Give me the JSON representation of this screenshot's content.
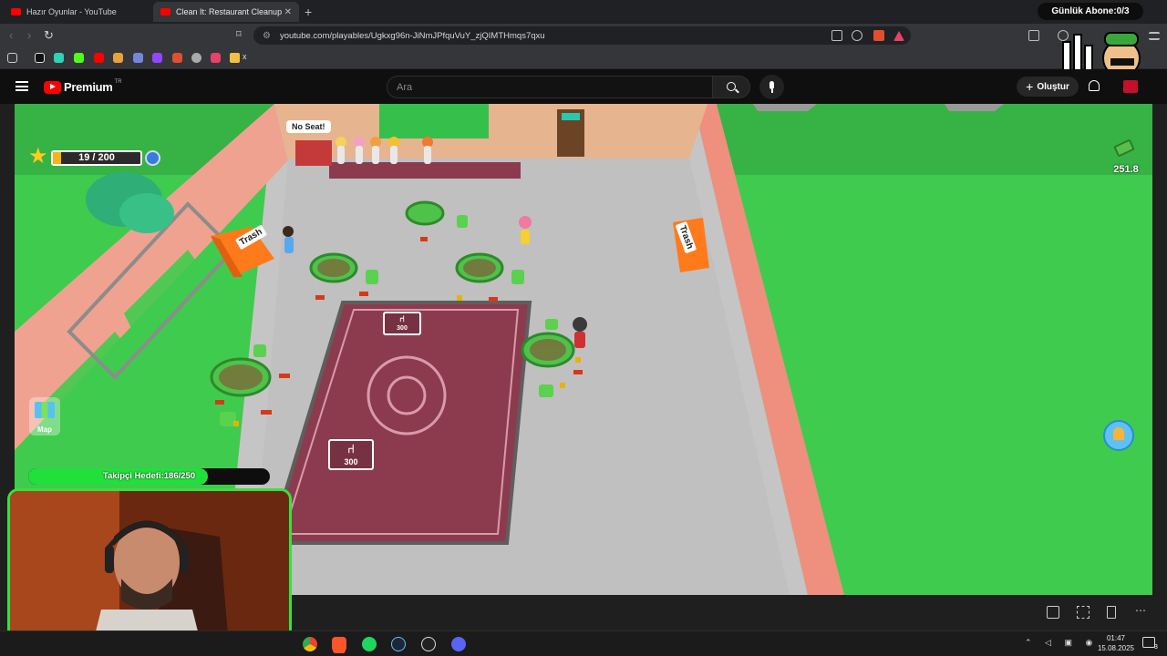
{
  "browser": {
    "tabs": [
      {
        "title": "Hazır Oyunlar - YouTube",
        "active": false
      },
      {
        "title": "Clean It: Restaurant Cleanup - Yo",
        "active": true
      }
    ],
    "new_tab": "+",
    "url": "youtube.com/playables/Ugkxg96n-JiNmJPfquVuY_zjQIMTHmqs7qxu",
    "bookmark_folder": "x"
  },
  "overlay": {
    "subscriber_goal": "Günlük Abone:0/3",
    "follower_goal_text": "Takipçi Hedefi:186/250",
    "follower_progress": 0.744
  },
  "youtube": {
    "brand": "Premium",
    "region": "TR",
    "search_placeholder": "Ara",
    "create_label": "Oluştur"
  },
  "game": {
    "level_progress_text": "19 / 200",
    "level_progress": 0.095,
    "money": "251.8",
    "no_seat_bubble": "No Seat!",
    "trash_left": "Trash",
    "trash_right": "Trash",
    "table_price_1": "300",
    "table_price_2": "300",
    "map_label": "Map",
    "colors": {
      "grass": "#3fcb4e",
      "floor": "#c9c9c9",
      "wall": "#f0a290",
      "carpet": "#8c3b4e",
      "trash": "#ff7a1a"
    }
  },
  "taskbar": {
    "time": "01:47",
    "date": "15.08.2025",
    "notifications": "3",
    "apps": [
      "chrome-icon",
      "brave-icon",
      "spotify-icon",
      "steam-icon",
      "obs-icon",
      "discord-icon"
    ]
  }
}
